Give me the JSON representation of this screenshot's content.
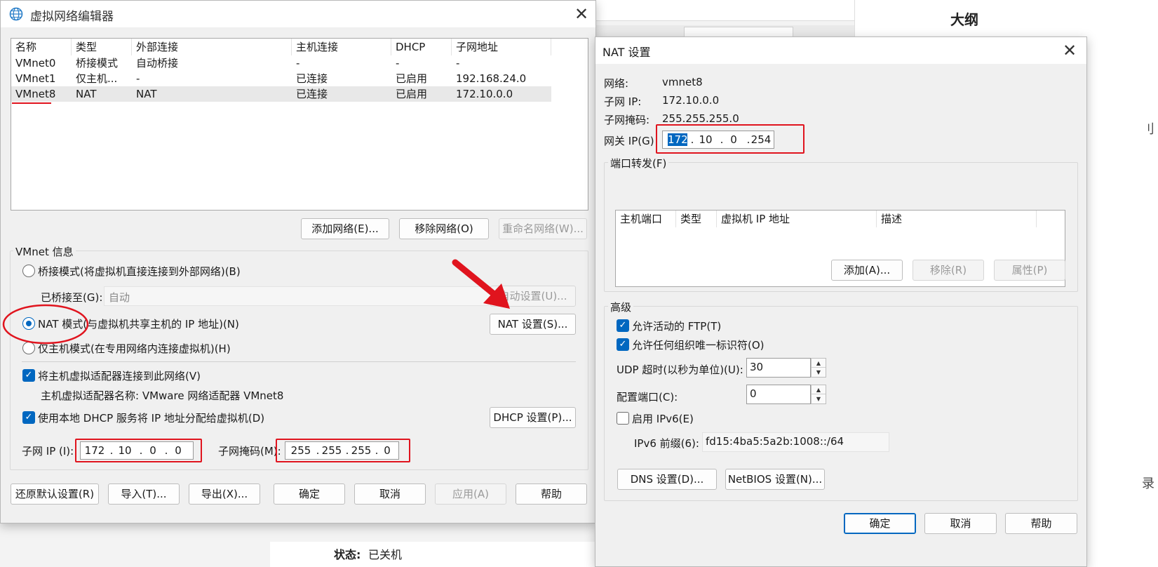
{
  "background": {
    "outline_title": "大纲",
    "edge_char_1": "刂",
    "edge_char_2": "录",
    "status_label": "状态:",
    "status_value": "已关机"
  },
  "vne": {
    "title": "虚拟网络编辑器",
    "columns": [
      "名称",
      "类型",
      "外部连接",
      "主机连接",
      "DHCP",
      "子网地址"
    ],
    "rows": [
      [
        "VMnet0",
        "桥接模式",
        "自动桥接",
        "-",
        "-",
        "-"
      ],
      [
        "VMnet1",
        "仅主机...",
        "-",
        "已连接",
        "已启用",
        "192.168.24.0"
      ],
      [
        "VMnet8",
        "NAT",
        "NAT",
        "已连接",
        "已启用",
        "172.10.0.0"
      ]
    ],
    "selected_row": 2,
    "add_network": "添加网络(E)...",
    "remove_network": "移除网络(O)",
    "rename_network": "重命名网络(W)...",
    "info_group": "VMnet 信息",
    "bridged_radio": "桥接模式(将虚拟机直接连接到外部网络)(B)",
    "bridged_to_label": "已桥接至(G):",
    "bridged_to_value": "自动",
    "auto_settings": "自动设置(U)...",
    "nat_radio": "NAT 模式(与虚拟机共享主机的 IP 地址)(N)",
    "nat_settings": "NAT 设置(S)...",
    "hostonly_radio": "仅主机模式(在专用网络内连接虚拟机)(H)",
    "connect_adapter": "将主机虚拟适配器连接到此网络(V)",
    "adapter_name": "主机虚拟适配器名称: VMware 网络适配器 VMnet8",
    "use_dhcp": "使用本地 DHCP 服务将 IP 地址分配给虚拟机(D)",
    "dhcp_settings": "DHCP 设置(P)...",
    "subnet_ip_label": "子网 IP (I):",
    "subnet_ip": [
      "172",
      "10",
      "0",
      "0"
    ],
    "subnet_mask_label": "子网掩码(M):",
    "subnet_mask": [
      "255",
      "255",
      "255",
      "0"
    ],
    "restore_defaults": "还原默认设置(R)",
    "import": "导入(T)...",
    "export": "导出(X)...",
    "ok": "确定",
    "cancel": "取消",
    "apply": "应用(A)",
    "help": "帮助"
  },
  "nat": {
    "title": "NAT 设置",
    "network_label": "网络:",
    "network_value": "vmnet8",
    "subnet_ip_label": "子网 IP:",
    "subnet_ip_value": "172.10.0.0",
    "subnet_mask_label": "子网掩码:",
    "subnet_mask_value": "255.255.255.0",
    "gateway_label": "网关 IP(G)",
    "gateway": [
      "172",
      "10",
      "0",
      "254"
    ],
    "port_forward_group": "端口转发(F)",
    "port_columns": [
      "主机端口",
      "类型",
      "虚拟机 IP 地址",
      "描述"
    ],
    "add": "添加(A)...",
    "remove": "移除(R)",
    "properties": "属性(P)",
    "advanced_group": "高级",
    "allow_ftp": "允许活动的 FTP(T)",
    "allow_uid": "允许任何组织唯一标识符(O)",
    "udp_timeout_label": "UDP 超时(以秒为单位)(U):",
    "udp_timeout_value": "30",
    "config_port_label": "配置端口(C):",
    "config_port_value": "0",
    "enable_ipv6": "启用 IPv6(E)",
    "ipv6_prefix_label": "IPv6 前缀(6):",
    "ipv6_prefix_value": "fd15:4ba5:5a2b:1008::/64",
    "dns_settings": "DNS 设置(D)...",
    "netbios_settings": "NetBIOS 设置(N)...",
    "ok": "确定",
    "cancel": "取消",
    "help": "帮助"
  },
  "colors": {
    "accent": "#0067c0",
    "annotation_red": "#e0141e"
  }
}
